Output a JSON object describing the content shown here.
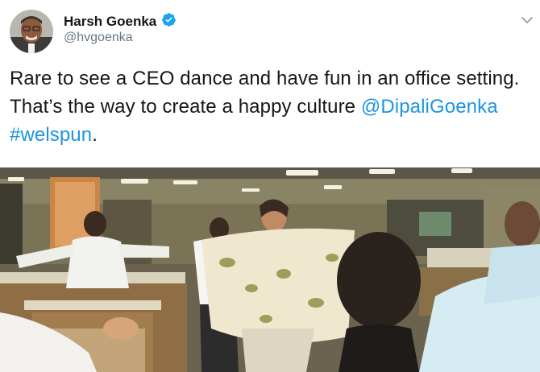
{
  "tweet": {
    "author": {
      "display_name": "Harsh Goenka",
      "handle": "@hvgoenka",
      "verified": true
    },
    "text": {
      "body": "Rare to see a CEO dance and have fun in an office setting. That’s the way to create a happy culture ",
      "mention": "@DipaliGoenka",
      "hashtag": "#welspun",
      "end": "."
    },
    "icons": {
      "verified": "verified-badge-icon",
      "menu": "chevron-down-icon"
    },
    "media": {
      "type": "video-frame"
    }
  },
  "colors": {
    "link": "#1b95e0",
    "verified": "#1da1f2",
    "text": "#14171a",
    "secondary": "#657786"
  }
}
